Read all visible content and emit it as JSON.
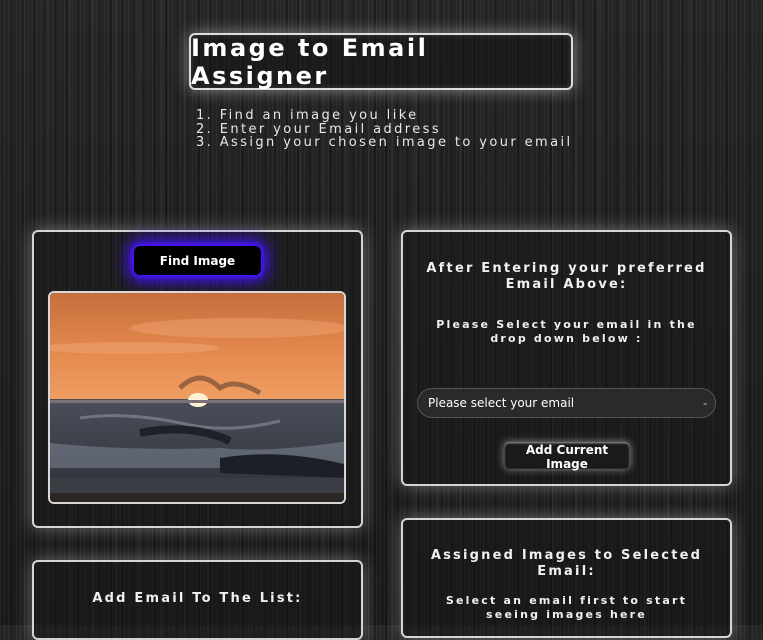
{
  "header": {
    "title": "Image to Email Assigner"
  },
  "steps": [
    "1. Find an image you like",
    "2. Enter your Email address",
    "3. Assign your chosen image to your email"
  ],
  "image_panel": {
    "find_button": "Find Image"
  },
  "email_select_panel": {
    "heading": "After Entering your preferred Email Above:",
    "instruction": "Please Select your email in the drop down below :",
    "select_value": "Please select your email",
    "add_button": "Add Current Image"
  },
  "add_email_panel": {
    "heading": "Add Email To The List:"
  },
  "assigned_panel": {
    "heading": "Assigned Images to Selected Email:",
    "message": "Select an email first to start seeing images here"
  },
  "colors": {
    "glow_accent": "#4411ff",
    "border": "#d5d5d5"
  }
}
